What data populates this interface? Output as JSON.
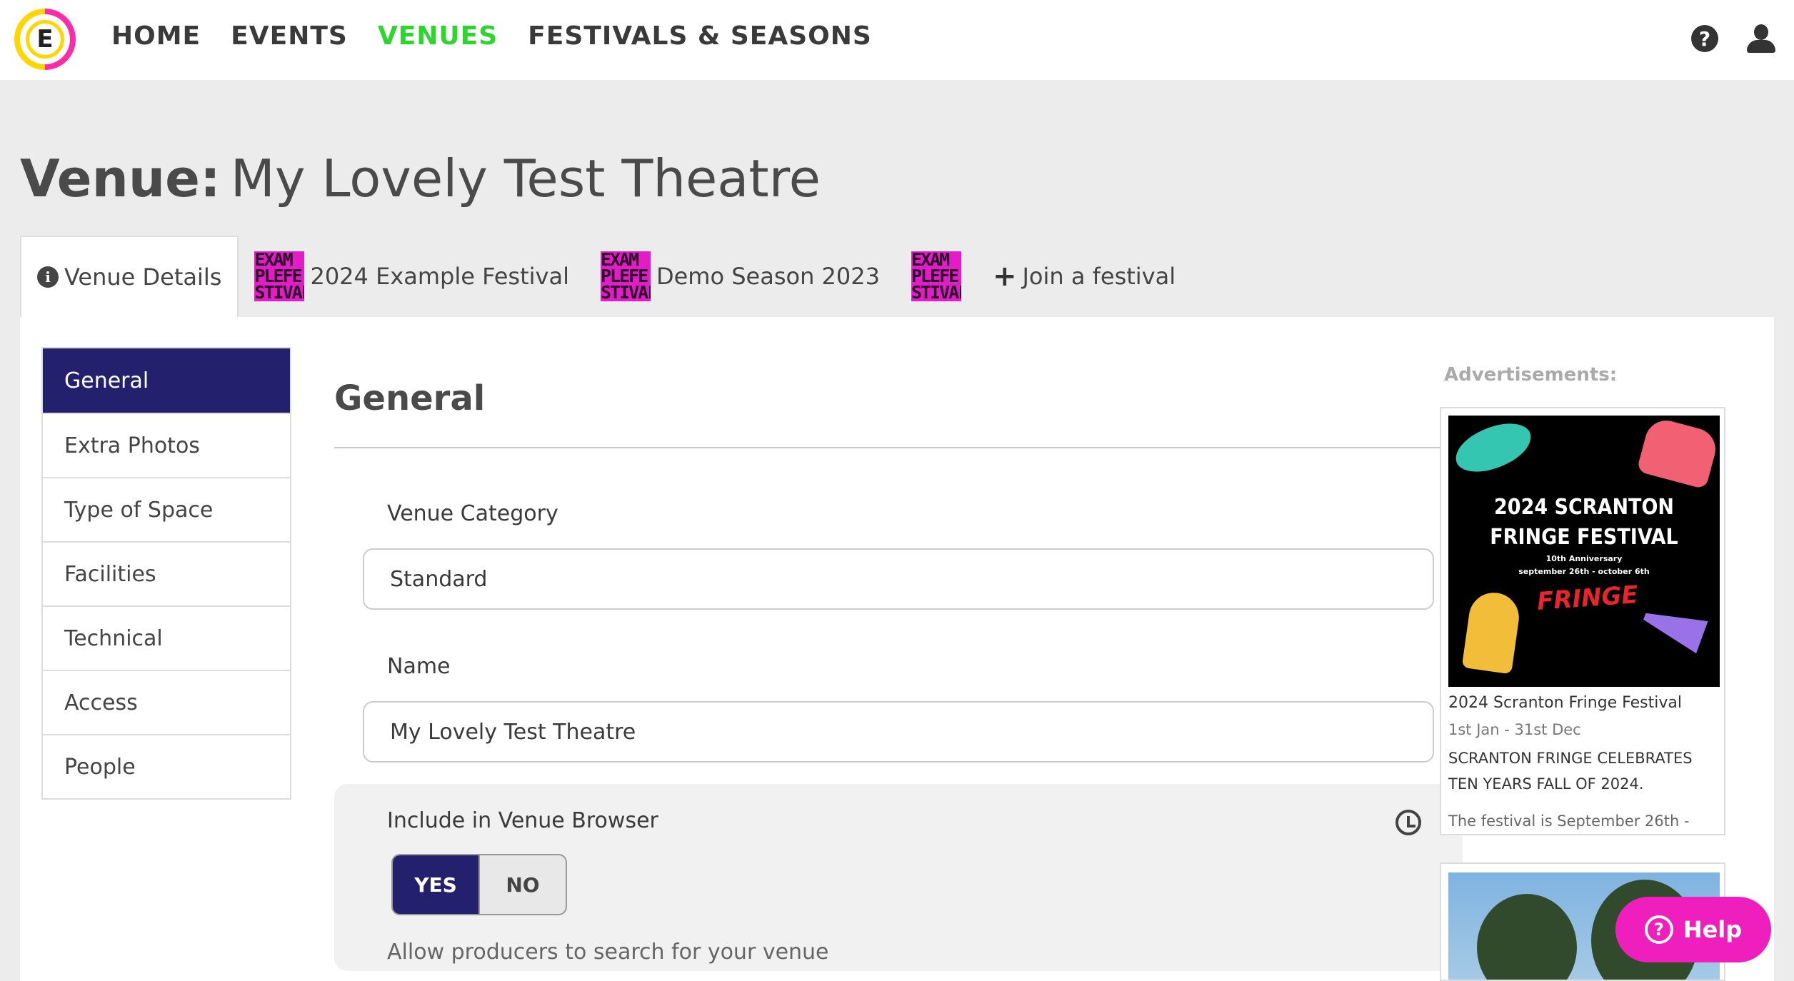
{
  "nav": {
    "logo_letter": "E",
    "links": [
      "HOME",
      "EVENTS",
      "VENUES",
      "FESTIVALS & SEASONS"
    ],
    "active": "VENUES",
    "help_icon_glyph": "?"
  },
  "page": {
    "title_label": "Venue:",
    "title_name": "My Lovely Test Theatre"
  },
  "tabs": {
    "venue_details": "Venue Details",
    "festival_1": "2024 Example Festival",
    "festival_2": "Demo Season 2023",
    "join": "Join a festival",
    "thumb_lines": [
      "EXAM",
      "PLEFE",
      "STIVAL"
    ]
  },
  "subnav": {
    "items": [
      "General",
      "Extra Photos",
      "Type of Space",
      "Facilities",
      "Technical",
      "Access",
      "People"
    ],
    "active": "General"
  },
  "form": {
    "section_title": "General",
    "category_label": "Venue Category",
    "category_value": "Standard",
    "name_label": "Name",
    "name_value": "My Lovely Test Theatre",
    "browser_label": "Include in Venue Browser",
    "yes": "YES",
    "no": "NO",
    "selected": "YES",
    "browser_help": "Allow producers to search for your venue"
  },
  "ads": {
    "title": "Advertisements:",
    "ad1": {
      "img_line1": "2024 SCRANTON",
      "img_line2": "FRINGE FESTIVAL",
      "img_anniv": "10th Anniversary",
      "img_dates": "september 26th - october 6th",
      "img_brand": "FRINGE",
      "name": "2024 Scranton Fringe Festival",
      "date": "1st Jan - 31st Dec",
      "desc": "SCRANTON FRINGE CELEBRATES TEN YEARS FALL OF 2024.",
      "teaser": "The festival is September 26th -"
    }
  },
  "help": {
    "label": "Help"
  },
  "colors": {
    "nav_active": "#2ed52e",
    "primary": "#23206e",
    "help_pink": "#ef1fbd"
  }
}
